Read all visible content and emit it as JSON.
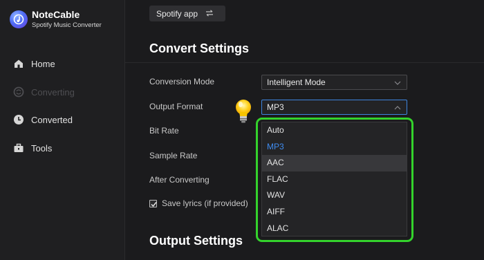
{
  "app": {
    "name": "NoteCable",
    "subtitle": "Spotify Music Converter"
  },
  "sidebar": {
    "items": [
      {
        "label": "Home",
        "icon": "home-icon",
        "enabled": true
      },
      {
        "label": "Converting",
        "icon": "converting-icon",
        "enabled": false
      },
      {
        "label": "Converted",
        "icon": "clock-icon",
        "enabled": true
      },
      {
        "label": "Tools",
        "icon": "toolbox-icon",
        "enabled": true
      }
    ]
  },
  "source": {
    "label": "Spotify app",
    "switch_icon": "swap-arrows-icon"
  },
  "convert_settings": {
    "title": "Convert Settings",
    "conversion_mode": {
      "label": "Conversion Mode",
      "value": "Intelligent Mode"
    },
    "output_format": {
      "label": "Output Format",
      "value": "MP3",
      "options": [
        "Auto",
        "MP3",
        "AAC",
        "FLAC",
        "WAV",
        "AIFF",
        "ALAC"
      ],
      "selected_index": 1,
      "hovered_index": 2
    },
    "bit_rate": {
      "label": "Bit Rate"
    },
    "sample_rate": {
      "label": "Sample Rate"
    },
    "after_converting": {
      "label": "After Converting"
    },
    "save_lyrics": {
      "label": "Save lyrics (if provided)",
      "checked": true
    }
  },
  "output_settings": {
    "title": "Output Settings"
  },
  "colors": {
    "accent": "#3e86e0",
    "highlight": "#34d32c",
    "background": "#1b1b1d"
  }
}
